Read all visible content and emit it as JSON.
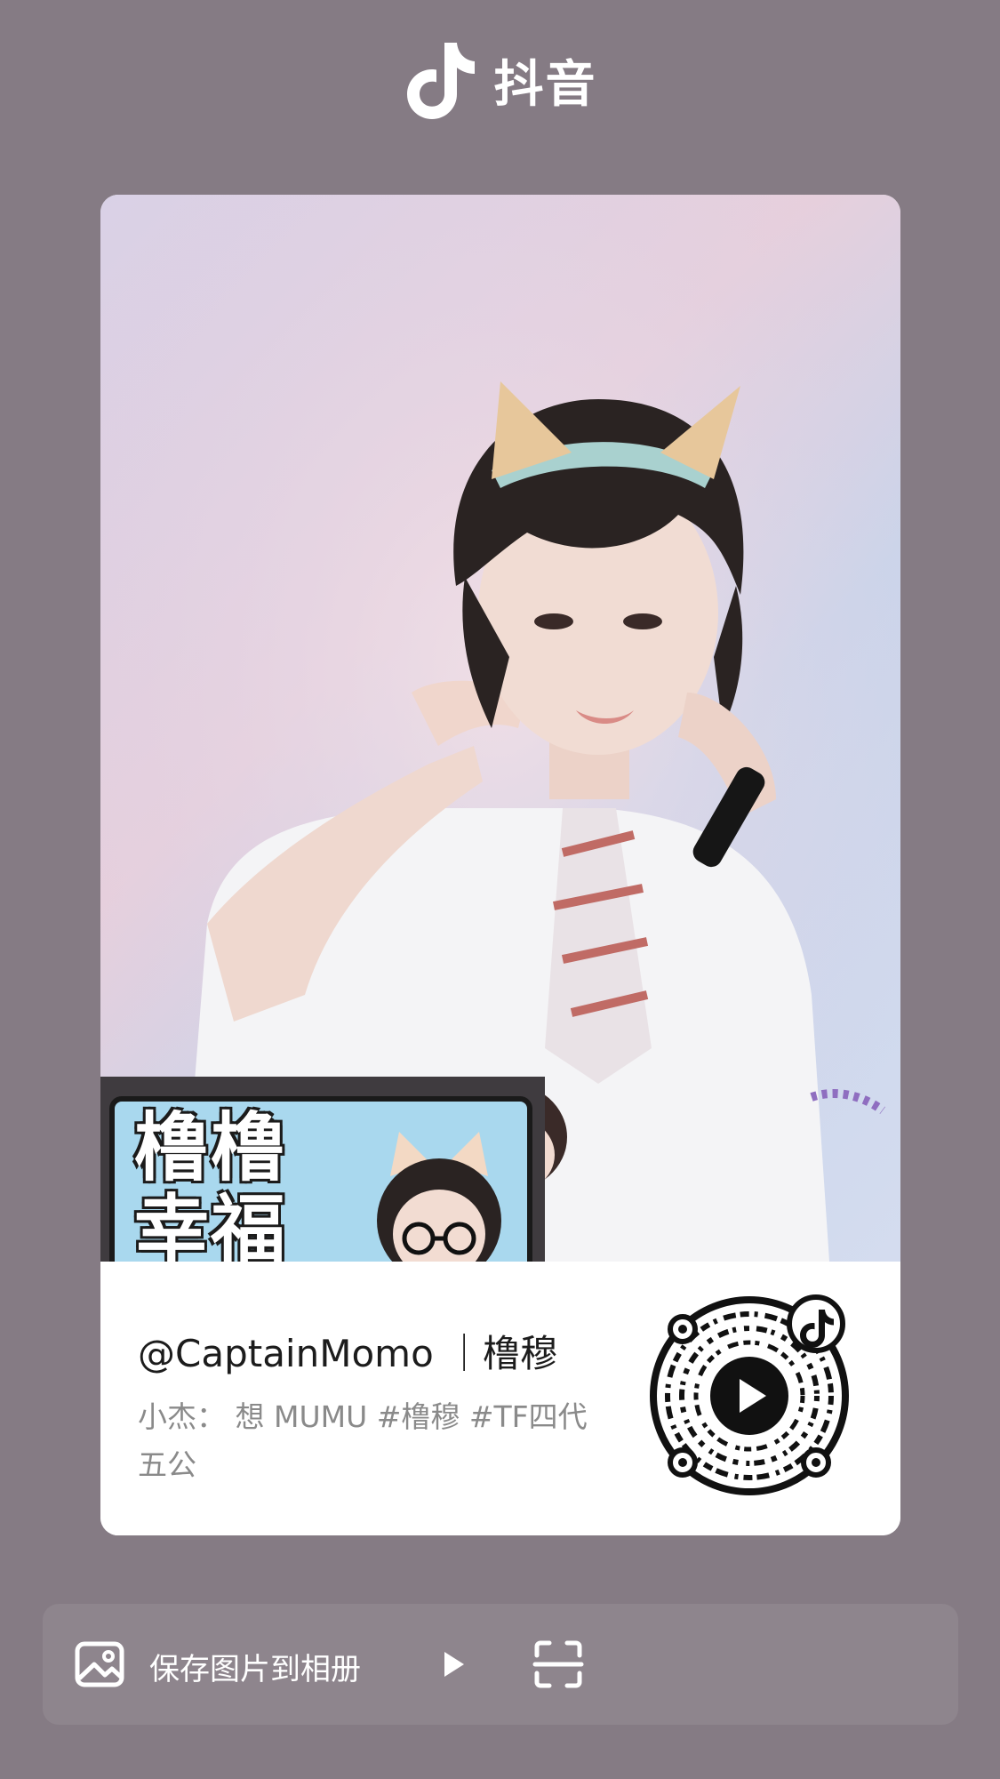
{
  "brand": {
    "name": "抖音",
    "icon": "douyin-logo-icon"
  },
  "card": {
    "sign": {
      "line1": "橹橹",
      "line2": "幸福"
    },
    "username": "@CaptainMomo ｜橹穆",
    "caption": "小杰： 想 MUMU #橹穆 #TF四代五公",
    "qr_icon": "qr-code-icon",
    "qr_center_icon": "play-icon",
    "qr_badge_icon": "douyin-logo-icon"
  },
  "actions": {
    "save_label": "保存图片到相册",
    "save_icon": "image-icon",
    "play_icon": "play-triangle-icon",
    "scan_icon": "scan-icon"
  },
  "colors": {
    "background": "#857b84",
    "card": "#ffffff",
    "text_primary": "#1c1c1c",
    "text_secondary": "#8a8a8a"
  }
}
